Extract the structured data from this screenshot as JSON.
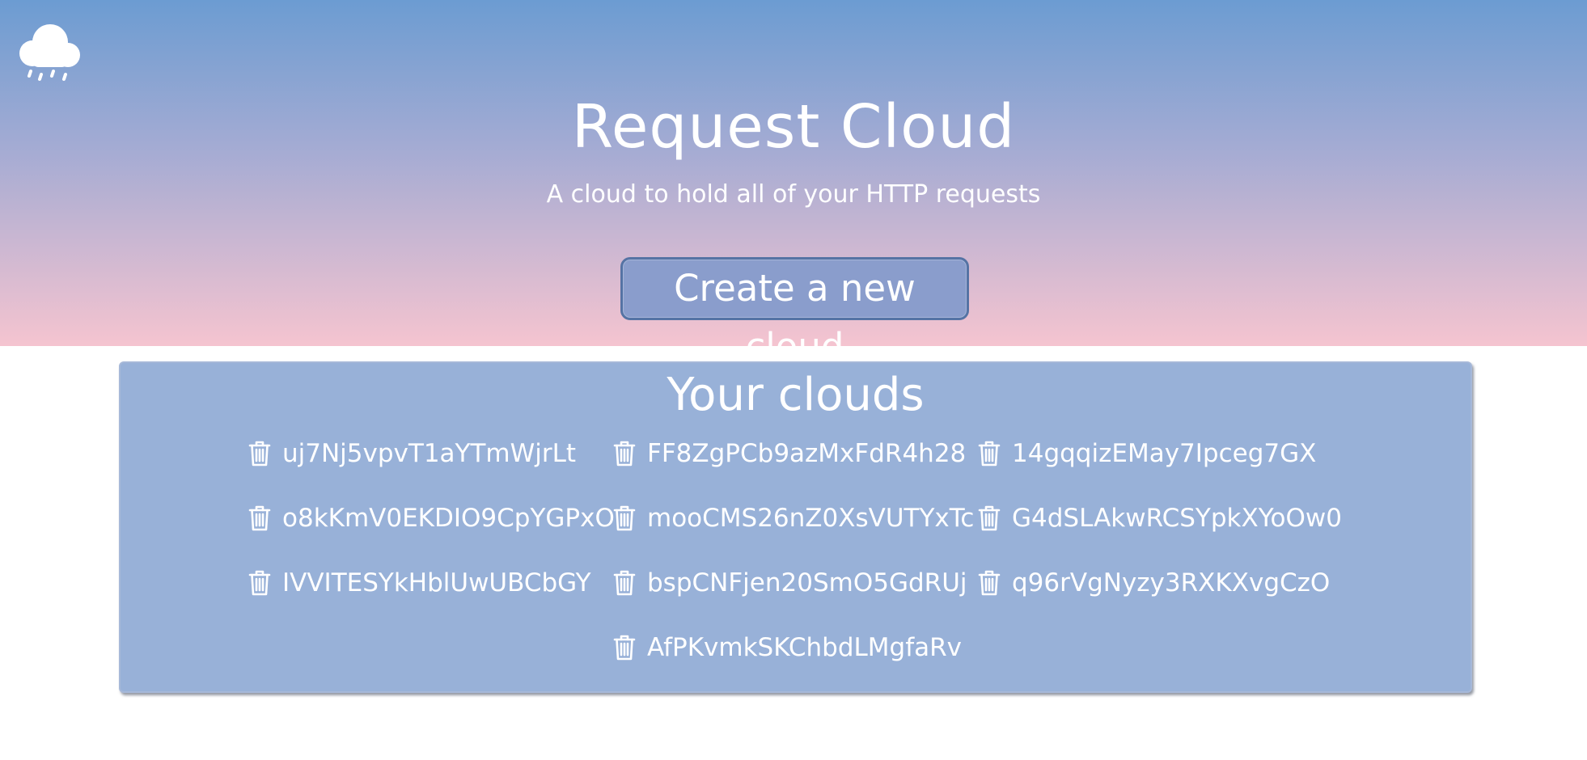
{
  "header": {
    "logo_icon": "cloud-rain-icon",
    "title": "Request Cloud",
    "subtitle": "A cloud to hold all of your HTTP requests",
    "create_button_label": "Create a new cloud"
  },
  "clouds": {
    "title": "Your clouds",
    "item_icon": "trash-icon",
    "items": [
      "uj7Nj5vpvT1aYTmWjrLt",
      "FF8ZgPCb9azMxFdR4h28",
      "14gqqizEMay7Ipceg7GX",
      "o8kKmV0EKDIO9CpYGPxO",
      "mooCMS26nZ0XsVUTYxTc",
      "G4dSLAkwRCSYpkXYoOw0",
      "IVVITESYkHblUwUBCbGY",
      "bspCNFjen20SmO5GdRUj",
      "q96rVgNyzy3RXKXvgCzO",
      "AfPKvmkSKChbdLMgfaRv"
    ]
  },
  "colors": {
    "gradient_top": "#6c9cd2",
    "gradient_bottom": "#f5c4d0",
    "panel_background": "#98b1d8",
    "button_background": "#8a9dcc",
    "button_border": "#5573a4",
    "text": "#ffffff"
  }
}
